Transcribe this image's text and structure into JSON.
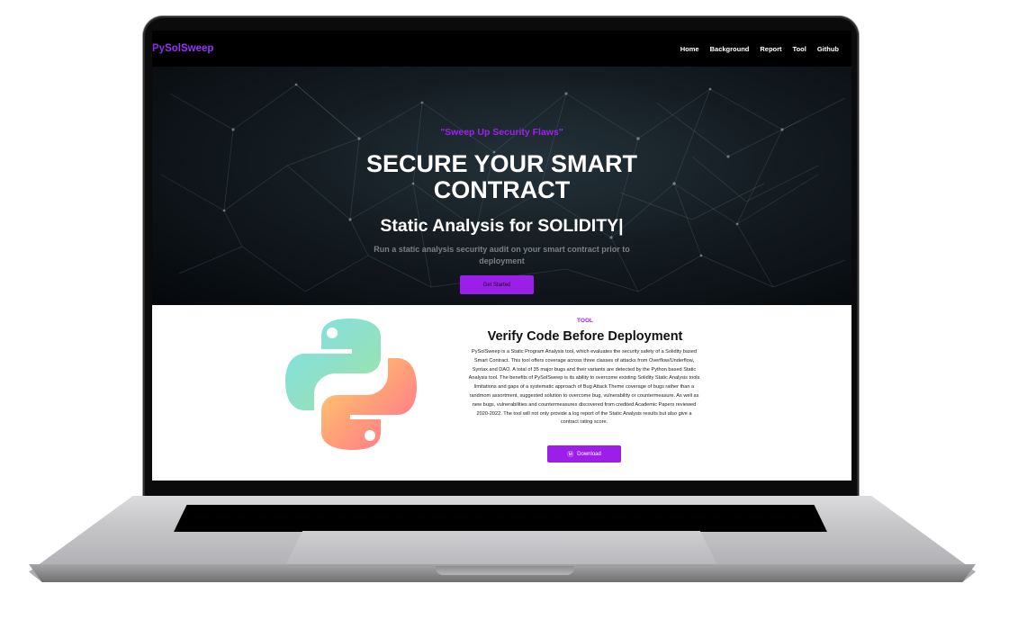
{
  "nav": {
    "brand_prefix": "Py",
    "brand_main": "SolSweep",
    "links": [
      "Home",
      "Background",
      "Report",
      "Tool",
      "Github"
    ]
  },
  "hero": {
    "tagline": "\"Sweep Up Security Flaws\"",
    "headline_line1": "SECURE YOUR SMART",
    "headline_line2": "CONTRACT",
    "subhead": "Static Analysis for SOLIDITY|",
    "description": "Run a static analysis security audit on your smart contract prior to deployment",
    "cta_label": "Get Started"
  },
  "tool": {
    "label": "TOOL",
    "title": "Verify Code Before Deployment",
    "description": "PySolSweep is a Static Program Analysis tool, which evaluates the security safety of a Solidity based Smart Contract. This tool offers coverage across three classes of attacks from Overflow/Underflow, Syntax and DAO. A total of 35 major bugs and their variants are detected by the Python based Static Analysis tool. The benefits of PySolSweep is its ability to overcome existing Solidity Static Analysis tools limitations and gaps of a systematic approach of Bug Attack Theme coverage of bugs rather than a randmom assortment, suggested solution to overcome bug, vulnerability or countermeasure. As well as new bugs, vulnerabilities and countermeasures discovered from credited Academic Papers reviewed 2020-2022. The tool will not only provide a log report of the Static Analysis results but also give a contract rating score.",
    "download_label": "Download",
    "download_icon": "wordpress-icon"
  },
  "colors": {
    "accent": "#9b1fe8",
    "nav_bg": "#000000",
    "hero_muted_text": "#7c7f84"
  }
}
